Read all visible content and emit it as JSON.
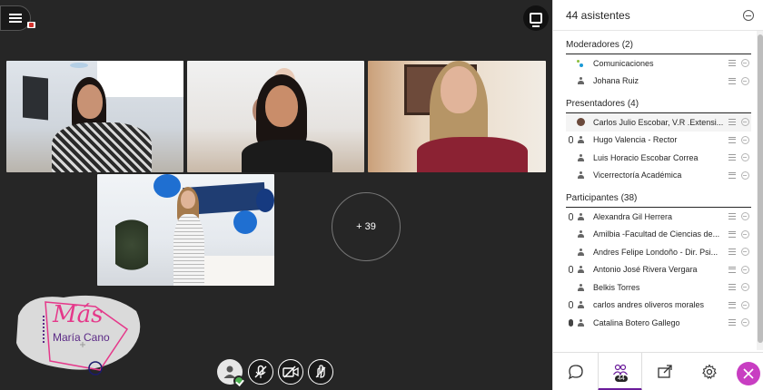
{
  "panel": {
    "title": "44 asistentes",
    "sections": [
      {
        "key": "moderators",
        "title": "Moderadores (2)",
        "rows": [
          {
            "name": "Comunicaciones",
            "mic": "",
            "icon": "comm"
          },
          {
            "name": "Johana Ruiz",
            "mic": "",
            "icon": "user"
          }
        ]
      },
      {
        "key": "presenters",
        "title": "Presentadores (4)",
        "rows": [
          {
            "name": "Carlos Julio Escobar, V.R .Extensi...",
            "mic": "",
            "icon": "photo"
          },
          {
            "name": "Hugo Valencia - Rector",
            "mic": "outline",
            "icon": "user"
          },
          {
            "name": "Luis Horacio Escobar Correa",
            "mic": "",
            "icon": "user"
          },
          {
            "name": "Vicerrectoría Académica",
            "mic": "",
            "icon": "user"
          }
        ]
      },
      {
        "key": "participants",
        "title": "Participantes (38)",
        "rows": [
          {
            "name": "Alexandra Gil Herrera",
            "mic": "outline",
            "icon": "user"
          },
          {
            "name": "Amilbia -Facultad de Ciencias de...",
            "mic": "",
            "icon": "user"
          },
          {
            "name": "Andres Felipe Londoño - Dir. Psi...",
            "mic": "",
            "icon": "user"
          },
          {
            "name": "Antonio José Rivera Vergara",
            "mic": "outline",
            "icon": "user"
          },
          {
            "name": "Belkis Torres",
            "mic": "",
            "icon": "user"
          },
          {
            "name": "carlos andres oliveros morales",
            "mic": "outline",
            "icon": "user"
          },
          {
            "name": "Catalina Botero Gallego",
            "mic": "filled",
            "icon": "user"
          }
        ]
      }
    ],
    "tabs": [
      {
        "name": "chat",
        "icon": "chat-icon"
      },
      {
        "name": "attendees",
        "icon": "attendees-icon",
        "count": "44"
      },
      {
        "name": "share",
        "icon": "share-icon"
      },
      {
        "name": "settings",
        "icon": "gear-icon"
      }
    ]
  },
  "stage": {
    "more_count": "+ 39",
    "logo_line1": "Más",
    "logo_line2": "María Cano"
  },
  "colors": {
    "accent": "#6a1b9a",
    "close": "#c83ec2",
    "logo_pink": "#e5388a",
    "logo_purple": "#5b2a86"
  }
}
